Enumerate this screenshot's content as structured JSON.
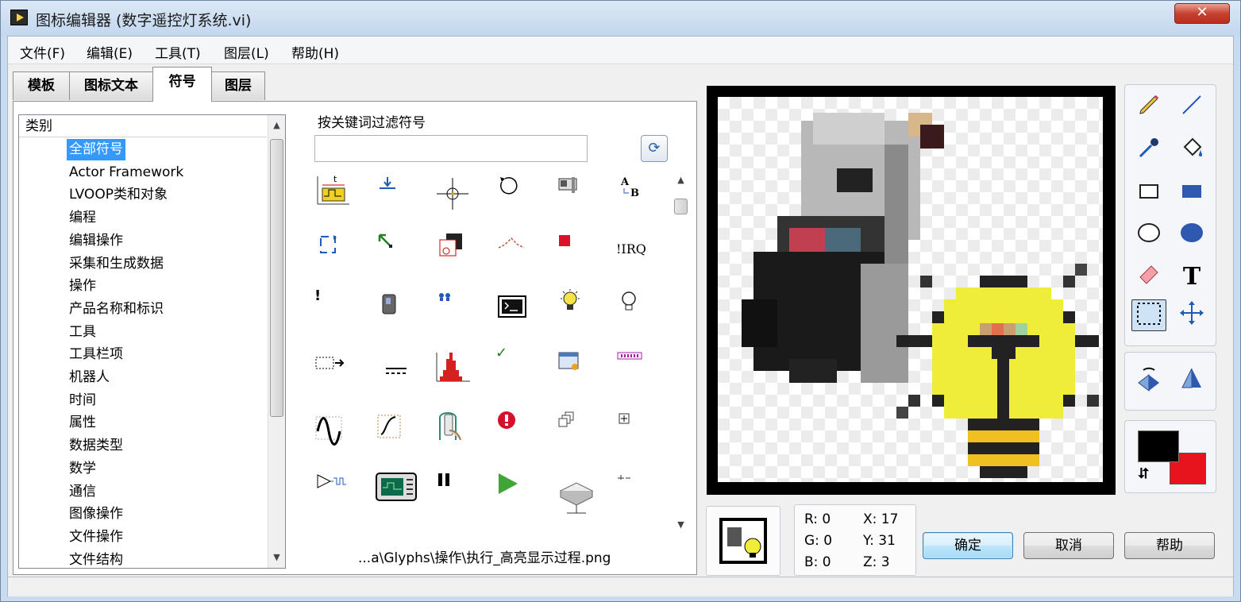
{
  "window": {
    "title": "图标编辑器 (数字遥控灯系统.vi)",
    "close_label": "✕"
  },
  "menu": [
    "文件(F)",
    "编辑(E)",
    "工具(T)",
    "图层(L)",
    "帮助(H)"
  ],
  "tabs": [
    "模板",
    "图标文本",
    "符号",
    "图层"
  ],
  "active_tab": "符号",
  "categories": {
    "header": "类别",
    "items": [
      "全部符号",
      "Actor Framework",
      "LVOOP类和对象",
      "编程",
      "编辑操作",
      "采集和生成数据",
      "操作",
      "产品名称和标识",
      "工具",
      "工具栏项",
      "机器人",
      "时间",
      "属性",
      "数据类型",
      "数学",
      "通信",
      "图像操作",
      "文件操作",
      "文件结构"
    ],
    "selected": "全部符号"
  },
  "filter": {
    "label": "按关键词过滤符号",
    "value": "",
    "refresh_icon": "refresh-icon"
  },
  "glyph_names": [
    "timing-waveform-glyph",
    "probe-down-glyph",
    "crosshair-glyph",
    "rotate-glyph",
    "device-glyph",
    "text-ab-glyph",
    "loop-glyph",
    "transform-glyph",
    "layered-window-glyph",
    "signal-peak-glyph",
    "stop-square-glyph",
    "irq-glyph",
    "exclamation-glyph",
    "meter-glyph",
    "dots-glyph",
    "terminal-glyph",
    "lightbulb-on-glyph",
    "lightbulb-off-glyph",
    "dotted-arrow-glyph",
    "dashed-line-glyph",
    "histogram-glyph",
    "checkmark-glyph",
    "dialog-glyph",
    "led-strip-glyph",
    "sine-wave-glyph",
    "curve-glyph",
    "remote-hand-glyph",
    "error-glyph",
    "stack-glyph",
    "plus-box-glyph",
    "amplifier-glyph",
    "oscilloscope-glyph",
    "pause-glyph",
    "play-glyph",
    "server-glyph",
    "small-glyph"
  ],
  "glyph_texts": {
    "irq": "!IRQ",
    "text_ab_a": "A",
    "text_ab_b": "B",
    "exclamation": "!"
  },
  "status_path": "...a\\Glyphs\\操作\\执行_高亮显示过程.png",
  "coords": {
    "r": "R: 0",
    "g": "G: 0",
    "b": "B: 0",
    "x": "X: 17",
    "y": "Y: 31",
    "z": "Z: 3"
  },
  "buttons": {
    "ok": "确定",
    "cancel": "取消",
    "help": "帮助"
  },
  "colors": {
    "foreground": "#000000",
    "background": "#e8141c",
    "accent": "#3399ff"
  },
  "tools": [
    "pencil-icon",
    "line-icon",
    "dropper-icon",
    "fill-icon",
    "rectangle-icon",
    "filled-rectangle-icon",
    "ellipse-icon",
    "filled-ellipse-icon",
    "eraser-icon",
    "text-tool-icon",
    "select-icon",
    "move-icon"
  ],
  "flip_tools": [
    "flip-horizontal-icon",
    "flip-vertical-icon"
  ]
}
